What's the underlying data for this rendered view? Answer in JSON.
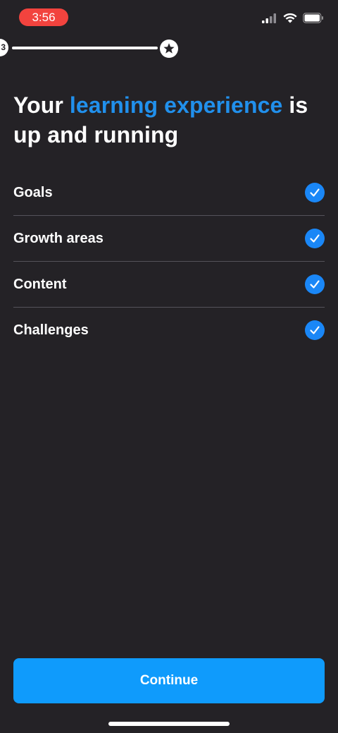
{
  "status_bar": {
    "time": "3:56",
    "time_pill_color": "#f2433e",
    "icons": [
      "cellular-signal-icon",
      "wifi-icon",
      "battery-icon"
    ]
  },
  "progress": {
    "step_label": "3",
    "end_icon": "star-icon",
    "fraction": 1.0
  },
  "heading": {
    "part1": "Your ",
    "highlight": "learning experience",
    "part2": " is up and running",
    "highlight_color": "#2190ec"
  },
  "checklist": {
    "items": [
      {
        "label": "Goals",
        "checked": true
      },
      {
        "label": "Growth areas",
        "checked": true
      },
      {
        "label": "Content",
        "checked": true
      },
      {
        "label": "Challenges",
        "checked": true
      }
    ],
    "check_color": "#1a87f7"
  },
  "footer": {
    "continue_label": "Continue",
    "button_color": "#0f9bfc"
  },
  "colors": {
    "background": "#242226",
    "divider": "#55535a"
  }
}
